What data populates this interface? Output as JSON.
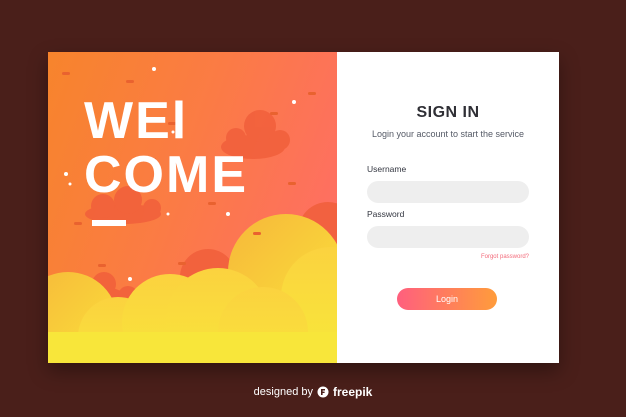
{
  "hero": {
    "welcome_line1": "WEl",
    "welcome_line2": "COME"
  },
  "form": {
    "title": "SIGN IN",
    "subtitle": "Login your account to start the service",
    "username_label": "Username",
    "username_value": "",
    "password_label": "Password",
    "password_value": "",
    "forgot_label": "Forgot password?",
    "login_label": "Login"
  },
  "footer": {
    "designed_by": "designed by",
    "brand": "freepik"
  },
  "colors": {
    "page_background": "#4a1f1a",
    "gradient_start": "#f7842c",
    "gradient_end": "#ff6b6b",
    "cloud_yellow": "#fbe03a",
    "cloud_orange": "#f15f3b",
    "button_start": "#ff5f7e",
    "button_end": "#ff9c3b",
    "input_background": "#eeeeee",
    "forgot_link": "#f36a7a"
  }
}
